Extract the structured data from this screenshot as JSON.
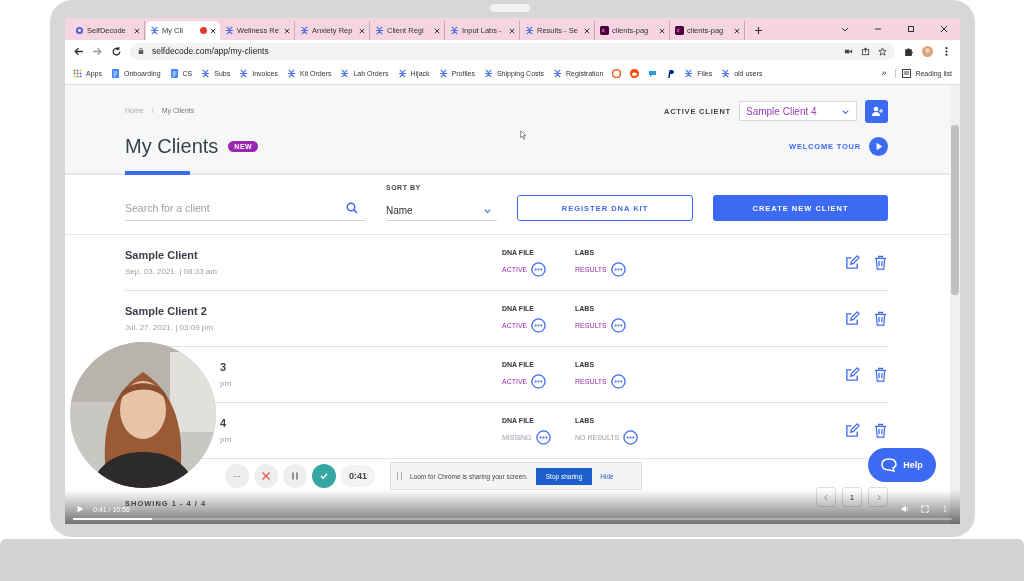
{
  "browser": {
    "tabs": [
      {
        "label": "SelfDecode",
        "kind": "gear",
        "selected": false,
        "recording": false
      },
      {
        "label": "My Cli",
        "kind": "person",
        "selected": true,
        "recording": true
      },
      {
        "label": "Wellness Re",
        "kind": "person",
        "selected": false,
        "recording": false
      },
      {
        "label": "Anxiety Rep",
        "kind": "person",
        "selected": false,
        "recording": false
      },
      {
        "label": "Client Regi",
        "kind": "person",
        "selected": false,
        "recording": false
      },
      {
        "label": "Input Labs -",
        "kind": "person",
        "selected": false,
        "recording": false
      },
      {
        "label": "Results - Se",
        "kind": "person",
        "selected": false,
        "recording": false
      },
      {
        "label": "clients-pag",
        "kind": "xd",
        "selected": false,
        "recording": false
      },
      {
        "label": "clients-pag",
        "kind": "xd",
        "selected": false,
        "recording": false
      }
    ],
    "url": "selfdecode.com/app/my-clients",
    "bookmarks": [
      {
        "label": "Apps",
        "kind": "apps"
      },
      {
        "label": "Onboarding",
        "kind": "doc"
      },
      {
        "label": "CS",
        "kind": "doc"
      },
      {
        "label": "Subs",
        "kind": "person"
      },
      {
        "label": "Invoices",
        "kind": "person"
      },
      {
        "label": "Kit Orders",
        "kind": "person"
      },
      {
        "label": "Lab Orders",
        "kind": "person"
      },
      {
        "label": "Hijack",
        "kind": "person"
      },
      {
        "label": "Profiles",
        "kind": "person"
      },
      {
        "label": "Shipping Costs",
        "kind": "person"
      },
      {
        "label": "Registration",
        "kind": "person"
      },
      {
        "kind": "c"
      },
      {
        "kind": "reddit"
      },
      {
        "kind": "chat"
      },
      {
        "kind": "paypal"
      },
      {
        "label": "Files",
        "kind": "person"
      },
      {
        "label": "old users",
        "kind": "person"
      }
    ],
    "overflow": "»",
    "reading_list": "Reading list"
  },
  "page": {
    "breadcrumb": [
      "Home",
      "My Clients"
    ],
    "breadcrumb_separator": "/",
    "active_client_label": "ACTIVE CLIENT",
    "active_client": "Sample Client 4",
    "title": "My Clients",
    "badge": "NEW",
    "welcome_tour": "WELCOME TOUR",
    "search": {
      "placeholder": "Search for a client"
    },
    "sort_label": "SORT BY",
    "sort_value": "Name",
    "register_button": "REGISTER DNA KIT",
    "create_button": "CREATE NEW CLIENT",
    "clients": [
      {
        "name": "Sample Client",
        "date": "Sep. 03. 2021. | 08:33 am",
        "dna_label": "DNA FILE",
        "dna_status": "ACTIVE",
        "dna_ok": true,
        "labs_label": "LABS",
        "labs_status": "RESULTS",
        "labs_ok": true
      },
      {
        "name": "Sample Client 2",
        "date": "Jul. 27. 2021. | 03:09 pm",
        "dna_label": "DNA FILE",
        "dna_status": "ACTIVE",
        "dna_ok": true,
        "labs_label": "LABS",
        "labs_status": "RESULTS",
        "labs_ok": true
      },
      {
        "name": "3",
        "date": "pm",
        "dna_label": "DNA FILE",
        "dna_status": "ACTIVE",
        "dna_ok": true,
        "labs_label": "LABS",
        "labs_status": "RESULTS",
        "labs_ok": true
      },
      {
        "name": "4",
        "date": "pm",
        "dna_label": "DNA FILE",
        "dna_status": "MISSING",
        "dna_ok": false,
        "labs_label": "LABS",
        "labs_status": "NO RESULTS",
        "labs_ok": false
      }
    ],
    "showing": "SHOWING 1 - 4 / 4",
    "page_number": "1",
    "help": "Help"
  },
  "loom": {
    "timer": "0:41",
    "more": "···",
    "notice": "Loom for Chrome is sharing your screen.",
    "stop": "Stop sharing",
    "hide": "Hide"
  },
  "video": {
    "time": "0:41 / 10:56",
    "level": 0.09
  }
}
